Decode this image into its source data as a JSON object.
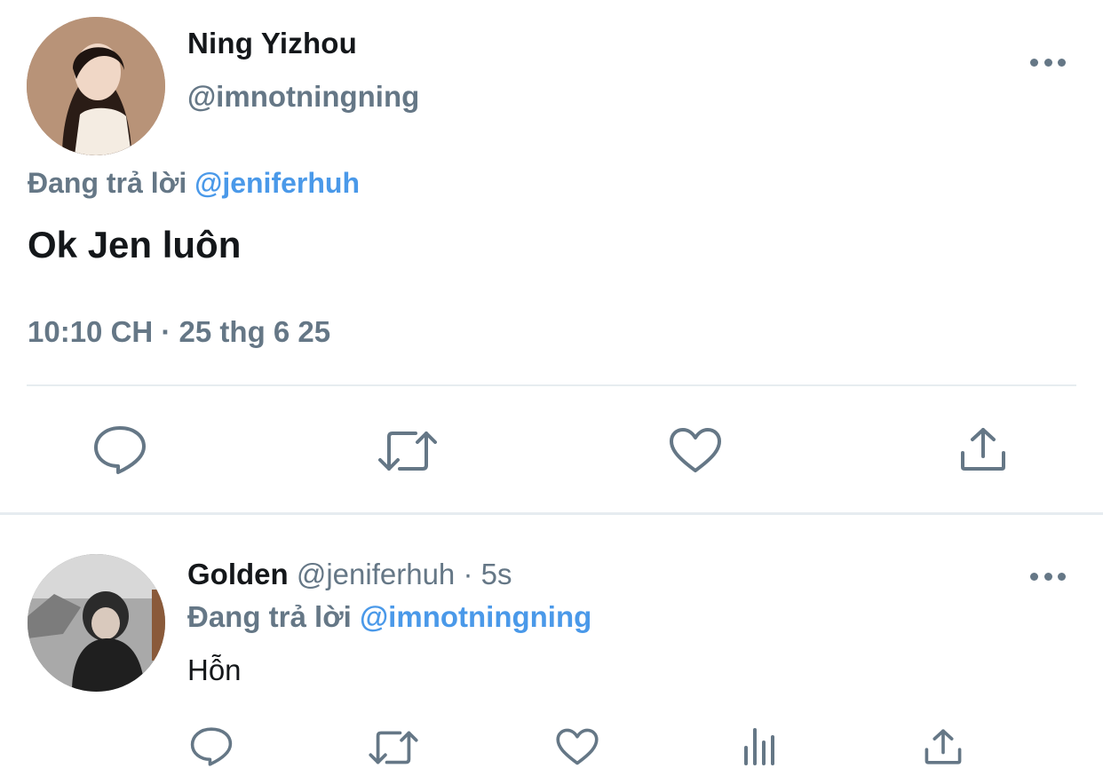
{
  "main_tweet": {
    "author_name": "Ning Yizhou",
    "author_handle": "@imnotningning",
    "replying_prefix": "Đang trả lời",
    "replying_to": "@jeniferhuh",
    "text": "Ok Jen luôn",
    "timestamp": "10:10 CH · 25 thg 6 25",
    "actions": [
      "reply-icon",
      "retweet-icon",
      "like-icon",
      "share-icon"
    ]
  },
  "reply_tweet": {
    "author_name": "Golden",
    "author_handle": "@jeniferhuh",
    "time_sep": "·",
    "time_ago": "5s",
    "replying_prefix": "Đang trả lời",
    "replying_to": "@imnotningning",
    "text": "Hỗn",
    "actions": [
      "reply-icon",
      "retweet-icon",
      "like-icon",
      "analytics-icon",
      "share-icon"
    ]
  },
  "colors": {
    "text_primary": "#14171a",
    "text_secondary": "#657786",
    "mention_blue": "#4a99e9",
    "divider": "#e6ecf0"
  }
}
